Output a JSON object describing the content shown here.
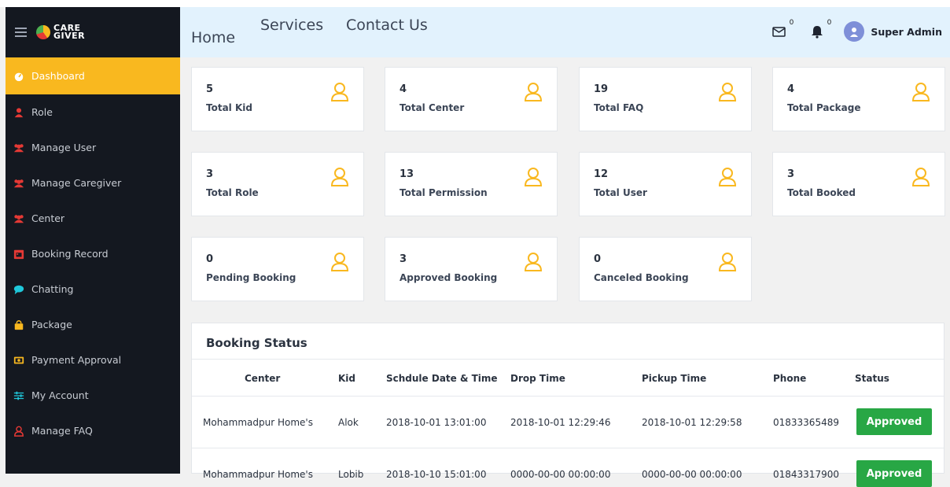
{
  "brand": {
    "line1": "CARE",
    "line2": "GIVER"
  },
  "sidebar": {
    "items": [
      {
        "label": "Dashboard",
        "icon": "dashboard-icon"
      },
      {
        "label": "Role",
        "icon": "user-icon"
      },
      {
        "label": "Manage User",
        "icon": "users-icon"
      },
      {
        "label": "Manage Caregiver",
        "icon": "users-icon"
      },
      {
        "label": "Center",
        "icon": "users-icon"
      },
      {
        "label": "Booking Record",
        "icon": "calendar-icon"
      },
      {
        "label": "Chatting",
        "icon": "chat-icon"
      },
      {
        "label": "Package",
        "icon": "bag-icon"
      },
      {
        "label": "Payment Approval",
        "icon": "money-icon"
      },
      {
        "label": "My Account",
        "icon": "sliders-icon"
      },
      {
        "label": "Manage FAQ",
        "icon": "person-outline-icon"
      }
    ]
  },
  "header": {
    "home": "Home",
    "services": "Services",
    "contact": "Contact Us",
    "mail_count": "0",
    "bell_count": "0",
    "user": "Super Admin"
  },
  "stats": [
    {
      "value": "5",
      "label": "Total Kid"
    },
    {
      "value": "4",
      "label": "Total Center"
    },
    {
      "value": "19",
      "label": "Total FAQ"
    },
    {
      "value": "4",
      "label": "Total Package"
    },
    {
      "value": "3",
      "label": "Total Role"
    },
    {
      "value": "13",
      "label": "Total Permission"
    },
    {
      "value": "12",
      "label": "Total User"
    },
    {
      "value": "3",
      "label": "Total Booked"
    },
    {
      "value": "0",
      "label": "Pending Booking"
    },
    {
      "value": "3",
      "label": "Approved Booking"
    },
    {
      "value": "0",
      "label": "Canceled Booking"
    }
  ],
  "booking": {
    "title": "Booking Status",
    "columns": [
      "Center",
      "Kid",
      "Schdule Date & Time",
      "Drop Time",
      "Pickup Time",
      "Phone",
      "Status"
    ],
    "rows": [
      [
        "Mohammadpur Home's",
        "Alok",
        "2018-10-01 13:01:00",
        "2018-10-01 12:29:46",
        "2018-10-01 12:29:58",
        "01833365489",
        "Approved"
      ],
      [
        "Mohammadpur Home's",
        "Lobib",
        "2018-10-10 15:01:00",
        "0000-00-00 00:00:00",
        "0000-00-00 00:00:00",
        "01843317900",
        "Approved"
      ]
    ]
  },
  "colors": {
    "accent": "#f9b81f",
    "sidebar": "#141820",
    "header": "#e2f2fd",
    "approved": "#28a745"
  }
}
